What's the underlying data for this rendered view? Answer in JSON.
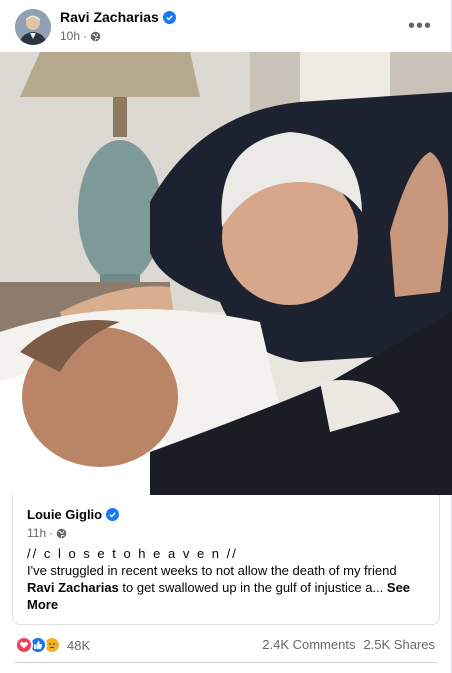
{
  "post": {
    "author": "Ravi Zacharias",
    "time": "10h",
    "more_label": "•••"
  },
  "shared": {
    "author": "Louie Giglio",
    "time": "11h",
    "line1": "// c l o s e t o h e a v e n //",
    "text_pre": "I've struggled in recent weeks to not allow the death of my friend ",
    "text_name": "Ravi Zacharias",
    "text_post": " to get swallowed up in the gulf of injustice a...",
    "see_more": "See More"
  },
  "engagement": {
    "reactions_count": "48K",
    "comments": "2.4K Comments",
    "shares": "2.5K Shares",
    "reaction_icons": [
      "love-icon",
      "like-icon",
      "sad-icon"
    ]
  },
  "colors": {
    "verified": "#1877f2",
    "love": "#f33e58",
    "like": "#1877f2",
    "sad": "#f7b125",
    "secondary_text": "#65676b"
  }
}
